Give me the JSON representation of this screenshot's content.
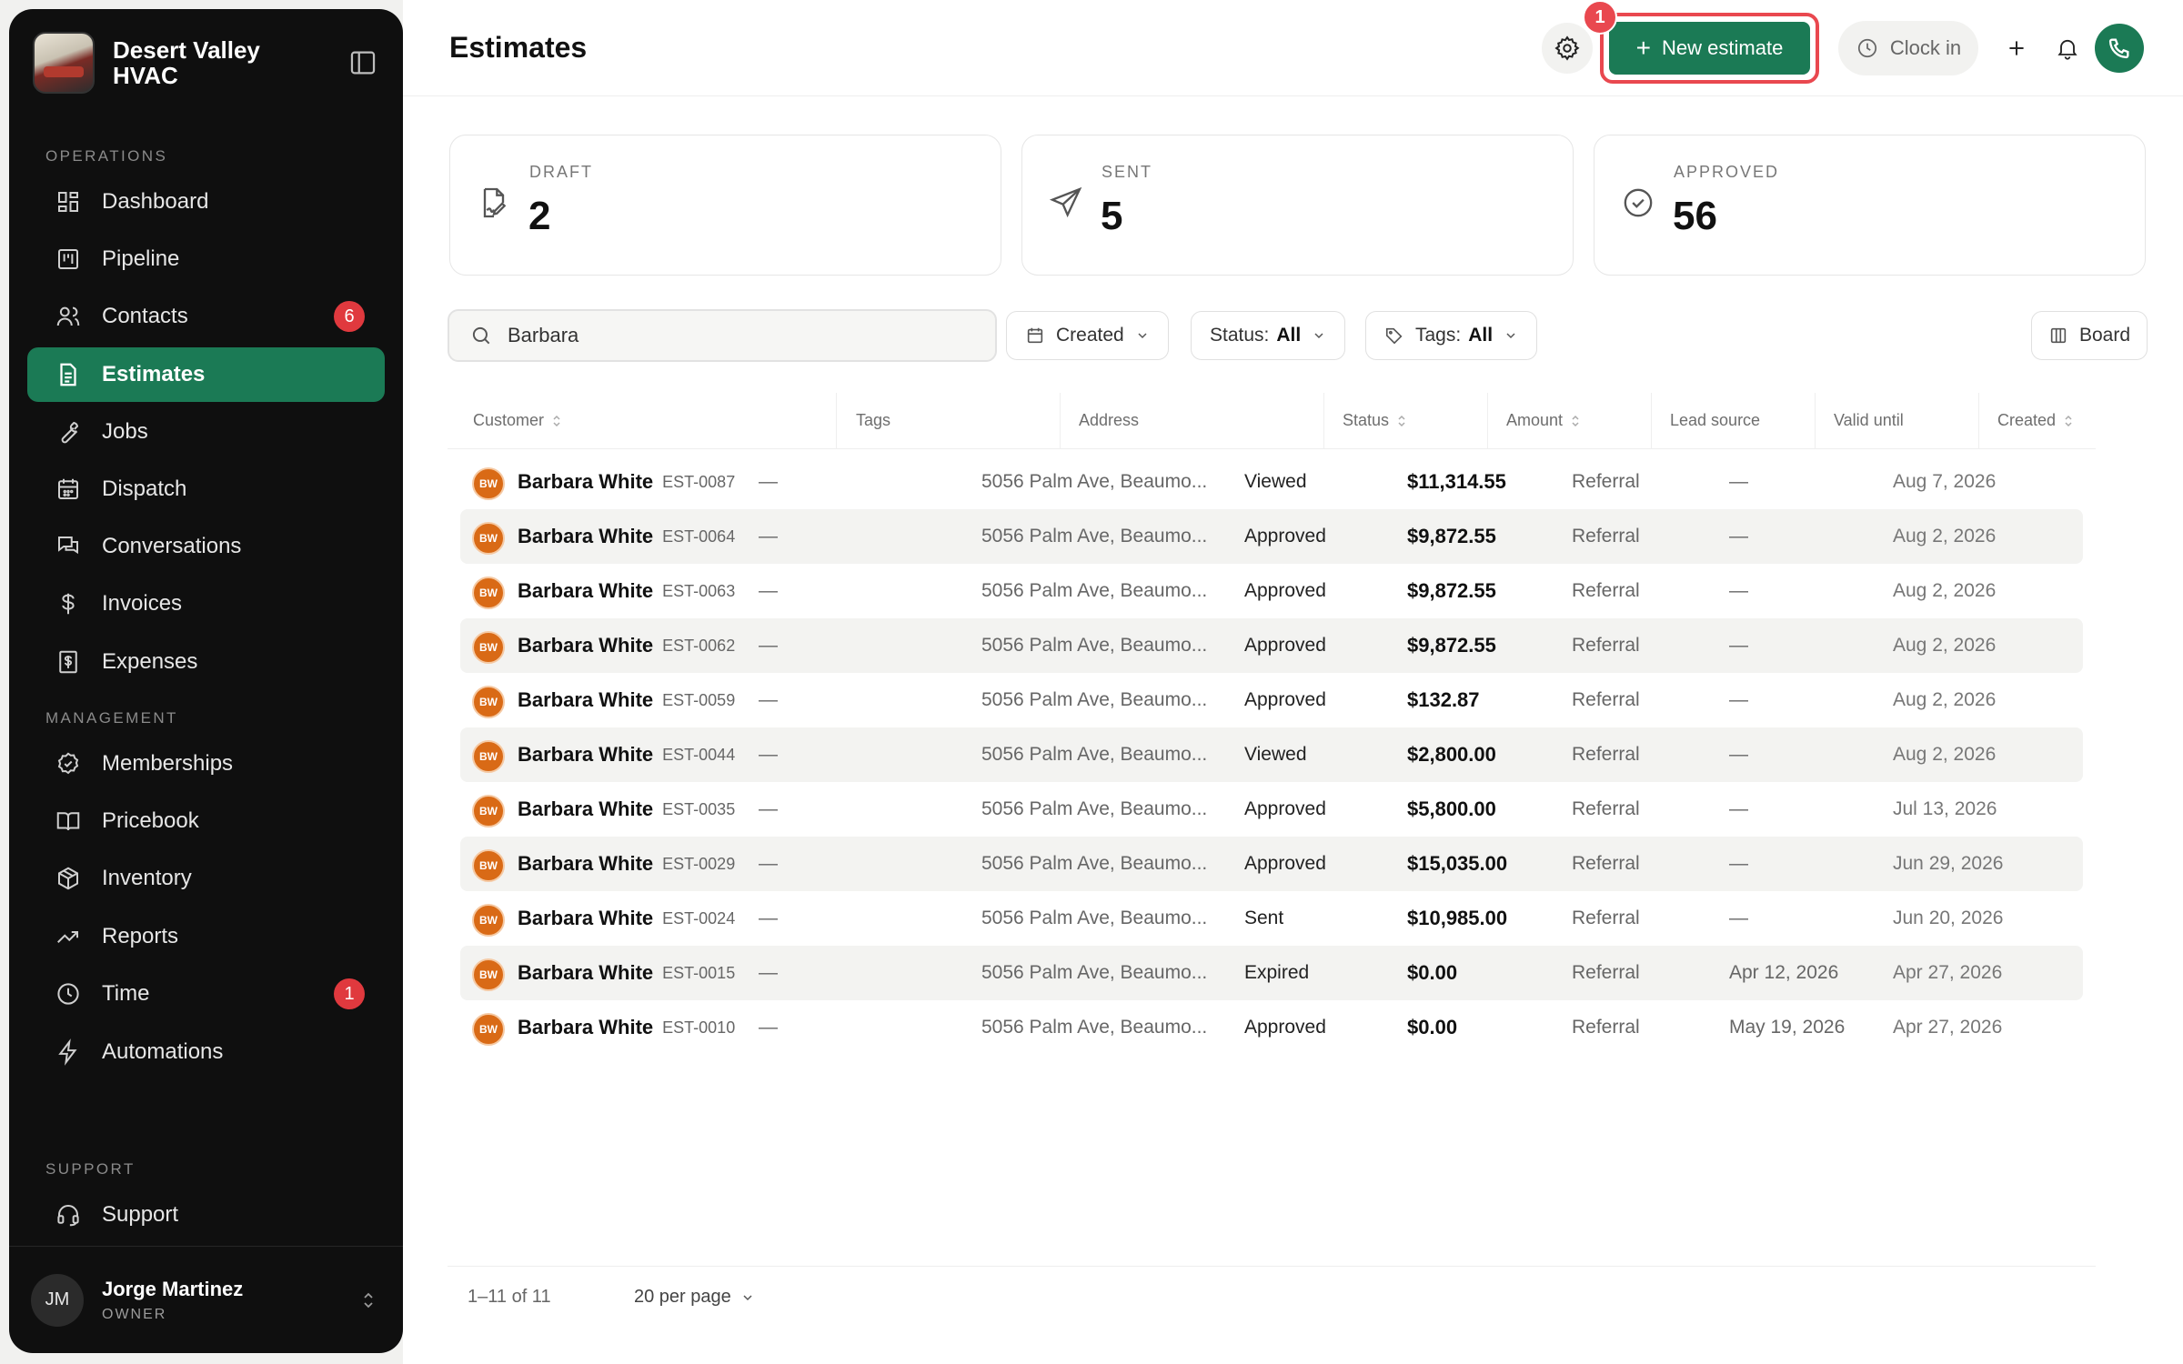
{
  "brand": {
    "name": "Desert Valley HVAC"
  },
  "sidebar": {
    "sections": {
      "operations": "OPERATIONS",
      "management": "MANAGEMENT",
      "support": "SUPPORT"
    },
    "items": [
      {
        "label": "Dashboard",
        "icon": "grid-icon"
      },
      {
        "label": "Pipeline",
        "icon": "kanban-icon"
      },
      {
        "label": "Contacts",
        "icon": "users-icon",
        "badge": "6"
      },
      {
        "label": "Estimates",
        "icon": "document-icon",
        "active": true
      },
      {
        "label": "Jobs",
        "icon": "wrench-icon"
      },
      {
        "label": "Dispatch",
        "icon": "calendar-icon"
      },
      {
        "label": "Conversations",
        "icon": "chat-icon"
      },
      {
        "label": "Invoices",
        "icon": "dollar-icon"
      },
      {
        "label": "Expenses",
        "icon": "receipt-icon"
      },
      {
        "label": "Memberships",
        "icon": "badge-check-icon"
      },
      {
        "label": "Pricebook",
        "icon": "book-icon"
      },
      {
        "label": "Inventory",
        "icon": "box-icon"
      },
      {
        "label": "Reports",
        "icon": "trend-icon"
      },
      {
        "label": "Time",
        "icon": "clock-icon",
        "badge": "1"
      },
      {
        "label": "Automations",
        "icon": "bolt-icon"
      },
      {
        "label": "Support",
        "icon": "headset-icon"
      }
    ],
    "user": {
      "initials": "JM",
      "name": "Jorge Martinez",
      "role": "OWNER"
    }
  },
  "header": {
    "title": "Estimates",
    "new_estimate_label": "New estimate",
    "step_badge": "1",
    "clock_in_label": "Clock in"
  },
  "stats": [
    {
      "label": "DRAFT",
      "value": "2",
      "icon": "file-signature-icon"
    },
    {
      "label": "SENT",
      "value": "5",
      "icon": "send-icon"
    },
    {
      "label": "APPROVED",
      "value": "56",
      "icon": "check-circle-icon"
    }
  ],
  "filters": {
    "search_value": "Barbara",
    "created_label": "Created",
    "status_label": "Status:",
    "status_value": "All",
    "tags_label": "Tags:",
    "tags_value": "All",
    "board_label": "Board"
  },
  "table": {
    "columns": [
      "Customer",
      "Tags",
      "Address",
      "Status",
      "Amount",
      "Lead source",
      "Valid until",
      "Created"
    ],
    "rows": [
      {
        "initials": "BW",
        "name": "Barbara White",
        "id": "EST-0087",
        "tags": "—",
        "address": "5056 Palm Ave, Beaumo...",
        "status": "Viewed",
        "amount": "$11,314.55",
        "lead": "Referral",
        "valid": "—",
        "created": "Aug 7, 2026"
      },
      {
        "initials": "BW",
        "name": "Barbara White",
        "id": "EST-0064",
        "tags": "—",
        "address": "5056 Palm Ave, Beaumo...",
        "status": "Approved",
        "amount": "$9,872.55",
        "lead": "Referral",
        "valid": "—",
        "created": "Aug 2, 2026"
      },
      {
        "initials": "BW",
        "name": "Barbara White",
        "id": "EST-0063",
        "tags": "—",
        "address": "5056 Palm Ave, Beaumo...",
        "status": "Approved",
        "amount": "$9,872.55",
        "lead": "Referral",
        "valid": "—",
        "created": "Aug 2, 2026"
      },
      {
        "initials": "BW",
        "name": "Barbara White",
        "id": "EST-0062",
        "tags": "—",
        "address": "5056 Palm Ave, Beaumo...",
        "status": "Approved",
        "amount": "$9,872.55",
        "lead": "Referral",
        "valid": "—",
        "created": "Aug 2, 2026"
      },
      {
        "initials": "BW",
        "name": "Barbara White",
        "id": "EST-0059",
        "tags": "—",
        "address": "5056 Palm Ave, Beaumo...",
        "status": "Approved",
        "amount": "$132.87",
        "lead": "Referral",
        "valid": "—",
        "created": "Aug 2, 2026"
      },
      {
        "initials": "BW",
        "name": "Barbara White",
        "id": "EST-0044",
        "tags": "—",
        "address": "5056 Palm Ave, Beaumo...",
        "status": "Viewed",
        "amount": "$2,800.00",
        "lead": "Referral",
        "valid": "—",
        "created": "Aug 2, 2026"
      },
      {
        "initials": "BW",
        "name": "Barbara White",
        "id": "EST-0035",
        "tags": "—",
        "address": "5056 Palm Ave, Beaumo...",
        "status": "Approved",
        "amount": "$5,800.00",
        "lead": "Referral",
        "valid": "—",
        "created": "Jul 13, 2026"
      },
      {
        "initials": "BW",
        "name": "Barbara White",
        "id": "EST-0029",
        "tags": "—",
        "address": "5056 Palm Ave, Beaumo...",
        "status": "Approved",
        "amount": "$15,035.00",
        "lead": "Referral",
        "valid": "—",
        "created": "Jun 29, 2026"
      },
      {
        "initials": "BW",
        "name": "Barbara White",
        "id": "EST-0024",
        "tags": "—",
        "address": "5056 Palm Ave, Beaumo...",
        "status": "Sent",
        "amount": "$10,985.00",
        "lead": "Referral",
        "valid": "—",
        "created": "Jun 20, 2026"
      },
      {
        "initials": "BW",
        "name": "Barbara White",
        "id": "EST-0015",
        "tags": "—",
        "address": "5056 Palm Ave, Beaumo...",
        "status": "Expired",
        "amount": "$0.00",
        "lead": "Referral",
        "valid": "Apr 12, 2026",
        "created": "Apr 27, 2026"
      },
      {
        "initials": "BW",
        "name": "Barbara White",
        "id": "EST-0010",
        "tags": "—",
        "address": "5056 Palm Ave, Beaumo...",
        "status": "Approved",
        "amount": "$0.00",
        "lead": "Referral",
        "valid": "May 19, 2026",
        "created": "Apr 27, 2026"
      }
    ]
  },
  "pagination": {
    "range": "1–11 of 11",
    "per_page": "20 per page"
  },
  "colors": {
    "accent": "#1b7a55",
    "alert": "#e9484f",
    "avatar": "#d96a16"
  }
}
